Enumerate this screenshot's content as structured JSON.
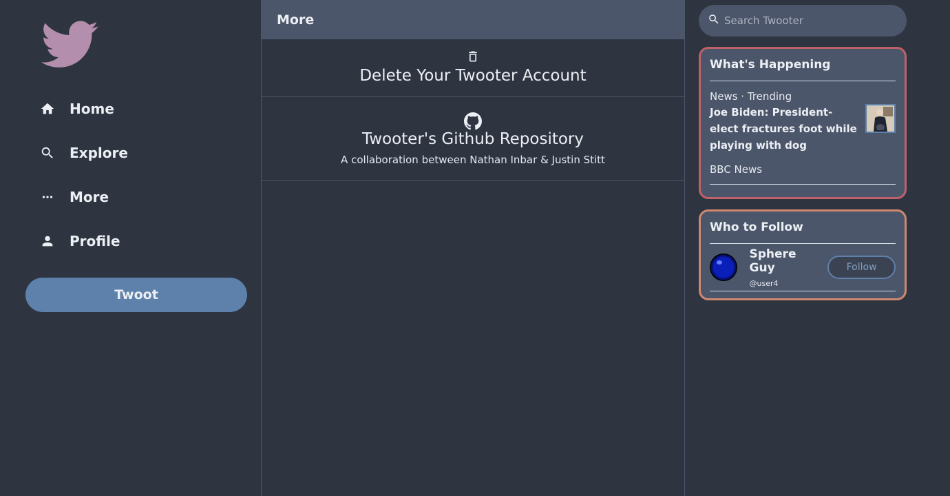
{
  "sidebar": {
    "logo_icon": "bird-logo-icon",
    "nav": [
      {
        "label": "Home",
        "icon": "home-icon"
      },
      {
        "label": "Explore",
        "icon": "search-icon"
      },
      {
        "label": "More",
        "icon": "more-dots-icon"
      },
      {
        "label": "Profile",
        "icon": "person-icon"
      }
    ],
    "twoot_label": "Twoot"
  },
  "main": {
    "header_title": "More",
    "items": [
      {
        "icon": "trash-icon",
        "title": "Delete Your Twooter Account"
      },
      {
        "icon": "github-icon",
        "title": "Twooter's Github Repository",
        "subtitle": "A collaboration between Nathan Inbar & Justin Stitt"
      }
    ]
  },
  "search": {
    "placeholder": "Search Twooter",
    "icon": "search-icon"
  },
  "happening": {
    "title": "What's Happening",
    "category": "News · Trending",
    "headline": "Joe Biden: President-elect fractures foot while playing with dog",
    "source": "BBC News"
  },
  "who_to_follow": {
    "title": "Who to Follow",
    "users": [
      {
        "name": "Sphere Guy",
        "handle": "@user4",
        "button": "Follow"
      }
    ]
  },
  "colors": {
    "background": "#2e3440",
    "panel": "#4c566a",
    "accent": "#5e81ac",
    "logo": "#b48ead",
    "happening_border": "#bf616a",
    "follow_border": "#d08770"
  }
}
